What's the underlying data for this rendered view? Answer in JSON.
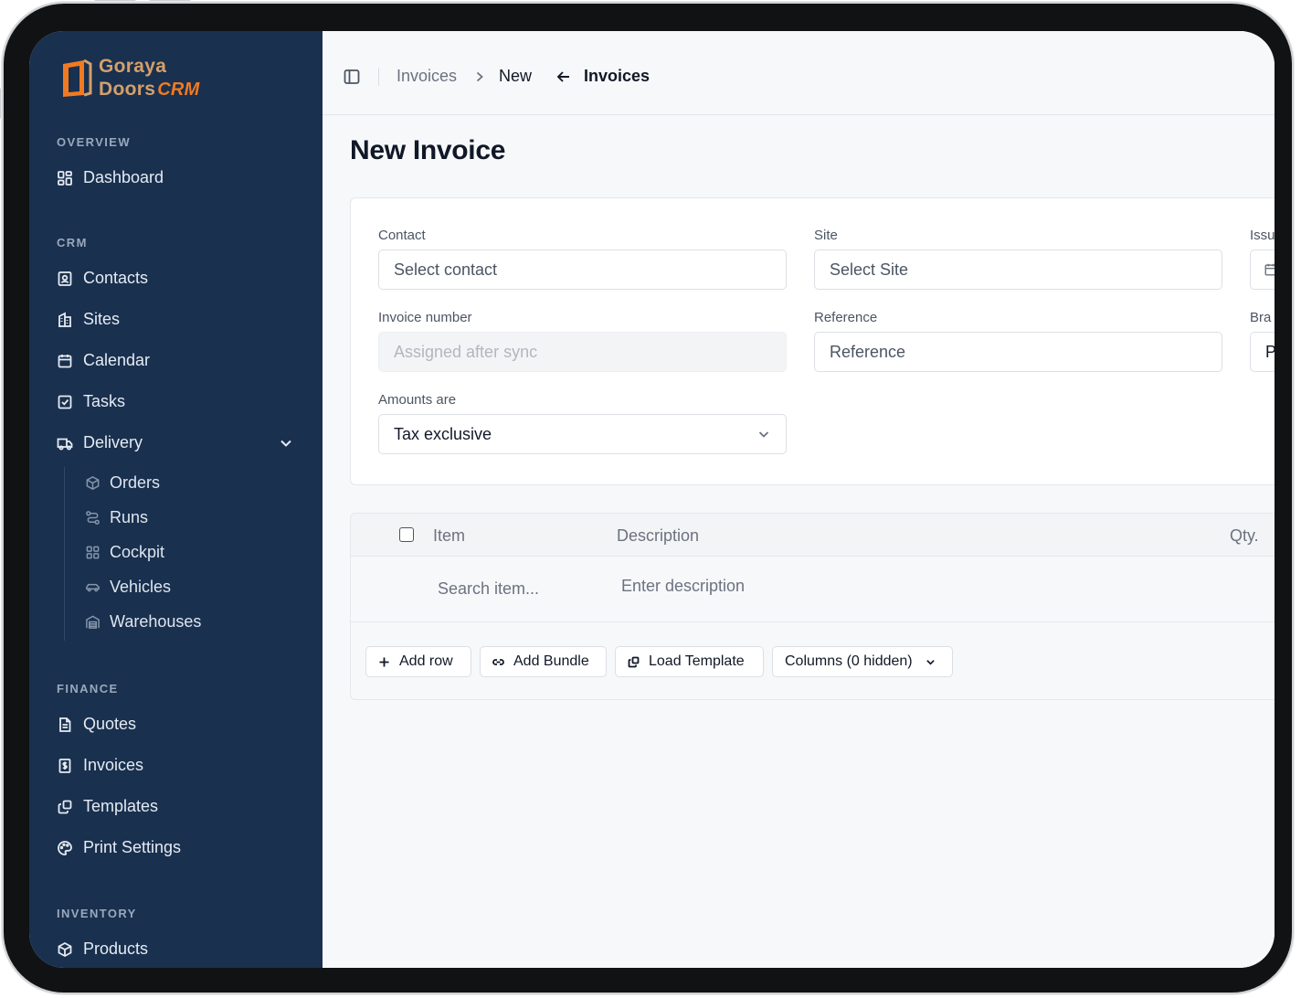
{
  "app": {
    "logo_line1": "Goraya",
    "logo_line2": "Doors",
    "logo_crm": "CRM"
  },
  "sidebar": {
    "sections": {
      "overview": "OVERVIEW",
      "crm": "CRM",
      "finance": "FINANCE",
      "inventory": "INVENTORY"
    },
    "items": {
      "dashboard": "Dashboard",
      "contacts": "Contacts",
      "sites": "Sites",
      "calendar": "Calendar",
      "tasks": "Tasks",
      "delivery": "Delivery",
      "quotes": "Quotes",
      "invoices": "Invoices",
      "templates": "Templates",
      "print_settings": "Print Settings",
      "products": "Products"
    },
    "delivery_sub": {
      "orders": "Orders",
      "runs": "Runs",
      "cockpit": "Cockpit",
      "vehicles": "Vehicles",
      "warehouses": "Warehouses"
    }
  },
  "topbar": {
    "crumb_parent": "Invoices",
    "crumb_current": "New",
    "back_label": "Invoices"
  },
  "page": {
    "title": "New Invoice"
  },
  "form": {
    "contact": {
      "label": "Contact",
      "placeholder": "Select contact"
    },
    "site": {
      "label": "Site",
      "placeholder": "Select Site"
    },
    "issue_label_partial": "Issu",
    "invoice_number": {
      "label": "Invoice number",
      "placeholder": "Assigned after sync"
    },
    "reference": {
      "label": "Reference",
      "placeholder": "Reference"
    },
    "branch_label_partial": "Bra",
    "branch_value_partial": "P",
    "amounts_are": {
      "label": "Amounts are",
      "value": "Tax exclusive"
    }
  },
  "table": {
    "headers": {
      "item": "Item",
      "description": "Description",
      "qty": "Qty."
    },
    "row": {
      "item_placeholder": "Search item...",
      "description_placeholder": "Enter description"
    },
    "actions": {
      "add_row": "Add row",
      "add_bundle": "Add Bundle",
      "load_template": "Load Template",
      "columns": "Columns (0 hidden)"
    }
  }
}
